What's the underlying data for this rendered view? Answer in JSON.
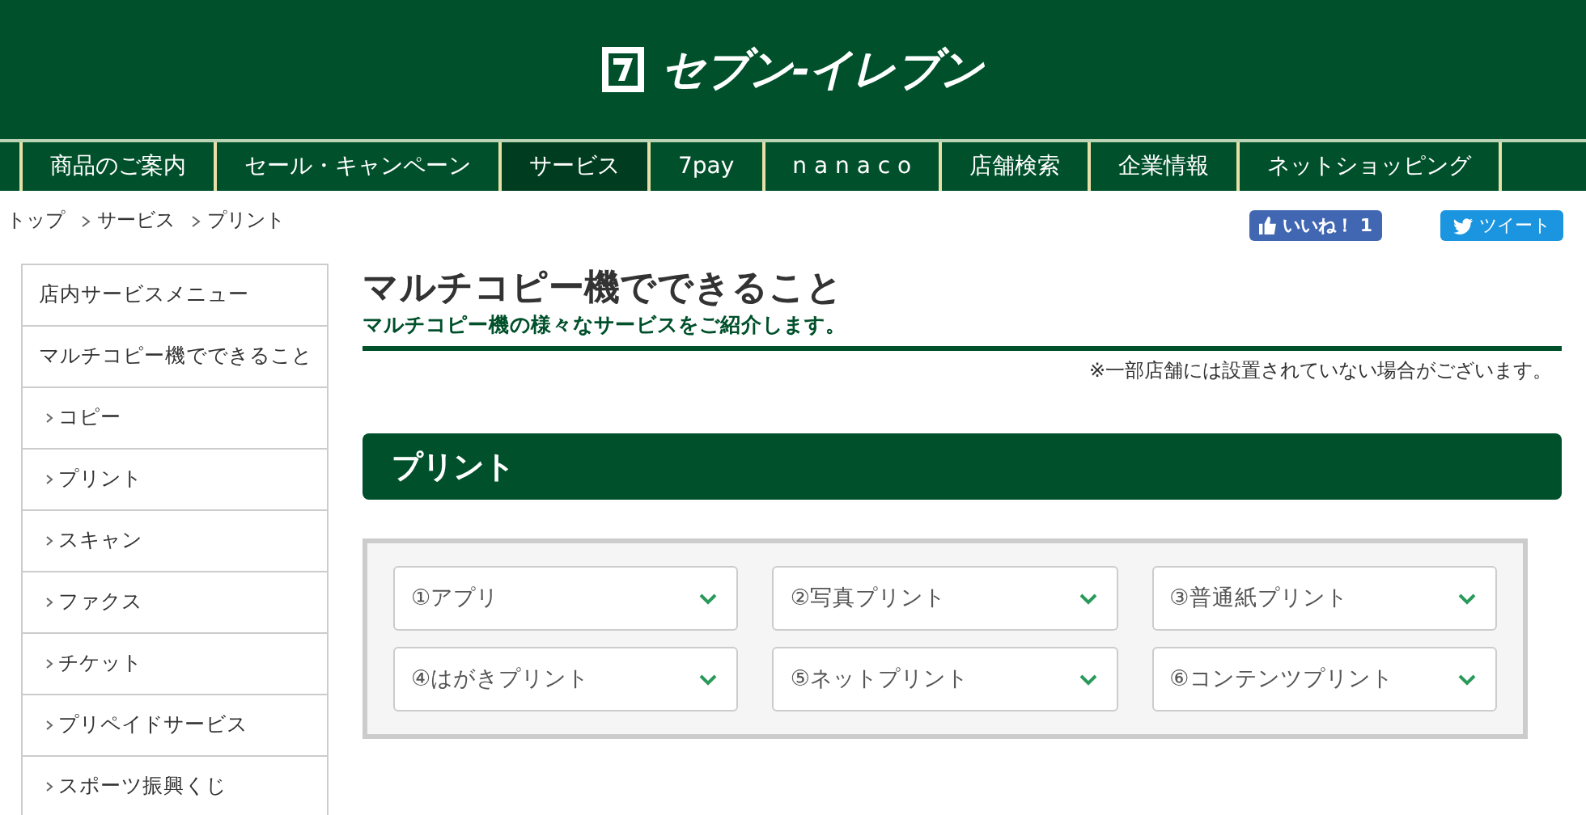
{
  "header": {
    "logo_text": "セブン-イレブン"
  },
  "nav": [
    {
      "label": "商品のご案内",
      "selected": false
    },
    {
      "label": "セール・キャンペーン",
      "selected": false
    },
    {
      "label": "サービス",
      "selected": true
    },
    {
      "label": "7pay",
      "selected": false
    },
    {
      "label": "n a n a c o",
      "selected": false
    },
    {
      "label": "店舗検索",
      "selected": false
    },
    {
      "label": "企業情報",
      "selected": false
    },
    {
      "label": "ネットショッピング",
      "selected": false
    }
  ],
  "breadcrumb": [
    "トップ",
    "サービス",
    "プリント"
  ],
  "social": {
    "like": "いいね！ 1",
    "tweet": "ツイート"
  },
  "sidebar": [
    {
      "label": "店内サービスメニュー",
      "kind": "heading"
    },
    {
      "label": "マルチコピー機でできること",
      "kind": "heading"
    },
    {
      "label": "コピー",
      "kind": "sub"
    },
    {
      "label": "プリント",
      "kind": "sub"
    },
    {
      "label": "スキャン",
      "kind": "sub"
    },
    {
      "label": "ファクス",
      "kind": "sub"
    },
    {
      "label": "チケット",
      "kind": "sub"
    },
    {
      "label": "プリペイドサービス",
      "kind": "sub"
    },
    {
      "label": "スポーツ振興くじ",
      "kind": "sub"
    }
  ],
  "page": {
    "title": "マルチコピー機でできること",
    "subtitle": "マルチコピー機の様々なサービスをご紹介します。",
    "note": "※一部店舗には設置されていない場合がございます。"
  },
  "section": {
    "title": "プリント",
    "items": [
      "①アプリ",
      "②写真プリント",
      "③普通紙プリント",
      "④はがきプリント",
      "⑤ネットプリント",
      "⑥コンテンツプリント"
    ]
  }
}
